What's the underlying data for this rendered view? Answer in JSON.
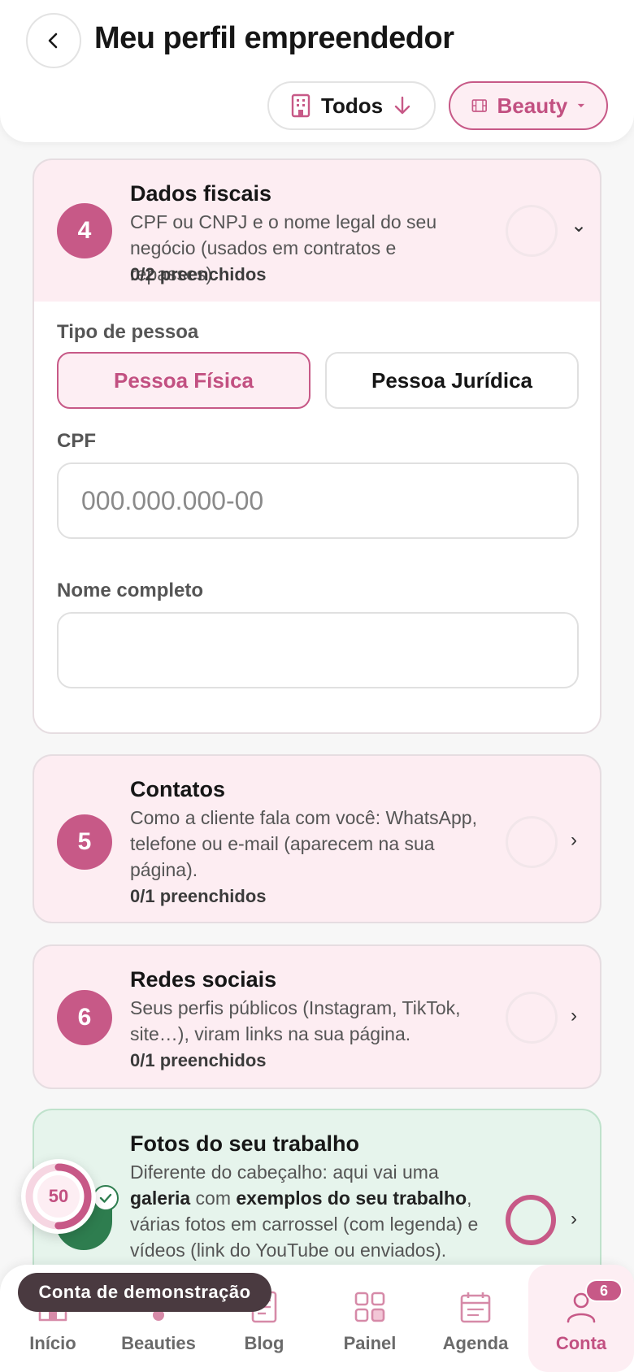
{
  "header": {
    "title": "Meu perfil empreendedor",
    "filter_todos": "Todos",
    "filter_beauty": "Beauty"
  },
  "steps": [
    {
      "number": "4",
      "title": "Dados fiscais",
      "description": "CPF ou CNPJ e o nome legal do seu negócio (usados em contratos e repasses).",
      "count": "0/2 preenchidos",
      "expanded": true
    },
    {
      "number": "5",
      "title": "Contatos",
      "description": "Como a cliente fala com você: WhatsApp, telefone ou e-mail (aparecem na sua página).",
      "count": "0/1 preenchidos"
    },
    {
      "number": "6",
      "title": "Redes sociais",
      "description": "Seus perfis públicos (Instagram, TikTok, site…), viram links na sua página.",
      "count": "0/1 preenchidos"
    }
  ],
  "fiscal_form": {
    "person_type_label": "Tipo de pessoa",
    "option_pf": "Pessoa Física",
    "option_pj": "Pessoa Jurídica",
    "selected": "Pessoa Física",
    "cpf_label": "CPF",
    "cpf_placeholder": "000.000.000-00",
    "cpf_value": "",
    "name_label": "Nome completo",
    "name_value": ""
  },
  "photos_step": {
    "title": "Fotos do seu trabalho",
    "desc_part1": "Diferente do cabeçalho: aqui vai uma ",
    "desc_bold1": "galeria",
    "desc_part2": " com ",
    "desc_bold2": "exemplos do seu trabalho",
    "desc_part3": ", várias fotos em carrossel (com legenda) e vídeos (link do YouTube ou enviados)."
  },
  "score": {
    "value": "50",
    "progress": 0.5
  },
  "demo_chip": "Conta de demonstração",
  "bottom_nav": {
    "items": [
      {
        "label": "Início",
        "icon": "home-icon"
      },
      {
        "label": "Beauties",
        "icon": "beauties-icon"
      },
      {
        "label": "Blog",
        "icon": "blog-icon"
      },
      {
        "label": "Painel",
        "icon": "grid-icon"
      },
      {
        "label": "Agenda",
        "icon": "calendar-icon"
      },
      {
        "label": "Conta",
        "icon": "user-icon",
        "active": true,
        "badge": "6"
      }
    ]
  },
  "colors": {
    "accent": "#c75987",
    "accent_light": "#fdeef3",
    "success": "#2e7d4f",
    "success_light": "#e6f4ec"
  }
}
